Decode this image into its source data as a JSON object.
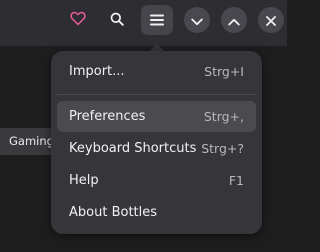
{
  "headerbar": {
    "icons": {
      "library": "heart-icon",
      "search": "search-icon",
      "menu": "hamburger-menu-icon",
      "minimize": "chevron-down-icon",
      "maximize": "chevron-up-icon",
      "close": "close-icon"
    },
    "library_icon_color": "#e85d9a"
  },
  "content": {
    "chip_label": "Gaming"
  },
  "menu": {
    "items": [
      {
        "label": "Import...",
        "accel": "Strg+I"
      },
      {
        "label": "Preferences",
        "accel": "Strg+,"
      },
      {
        "label": "Keyboard Shortcuts",
        "accel": "Strg+?"
      },
      {
        "label": "Help",
        "accel": "F1"
      },
      {
        "label": "About Bottles",
        "accel": ""
      }
    ]
  },
  "colors": {
    "headerbar": "#2e2e32",
    "popover": "#36363a",
    "hover": "#4a4a4f",
    "background": "#1e1e1e"
  }
}
